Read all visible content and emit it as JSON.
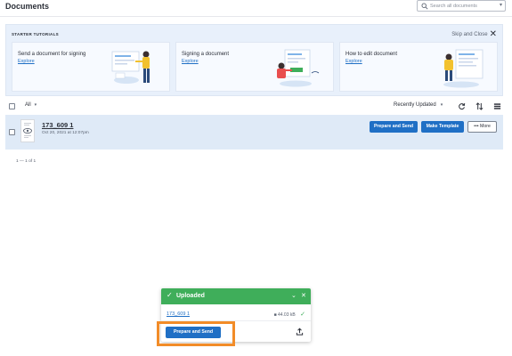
{
  "header": {
    "title": "Documents",
    "search_placeholder": "Search all documents"
  },
  "tutorials": {
    "heading": "STARTER TUTORIALS",
    "skip_label": "Skip and Close",
    "cards": [
      {
        "title": "Send a document for signing",
        "link": "Explore"
      },
      {
        "title": "Signing a document",
        "link": "Explore"
      },
      {
        "title": "How to edit document",
        "link": "Explore"
      }
    ]
  },
  "toolbar": {
    "filter": "All",
    "sort": "Recently Updated"
  },
  "documents": [
    {
      "name": "173_609 1",
      "date": "Oct 20, 2021 at 12:07pm",
      "primary_action": "Prepare and Send",
      "secondary_action": "Make Template",
      "more_label": "More"
    }
  ],
  "pagination": "1 — 1 of 1",
  "upload_panel": {
    "status": "Uploaded",
    "file_name": "173_609 1",
    "file_size": "44.03 kB",
    "action_label": "Prepare and Send"
  },
  "colors": {
    "primary": "#1f6fc5",
    "success": "#3fae5a",
    "highlight": "#f28c28",
    "tutorial_bg": "#e8f0fb",
    "row_selected": "#dfeaf7"
  }
}
